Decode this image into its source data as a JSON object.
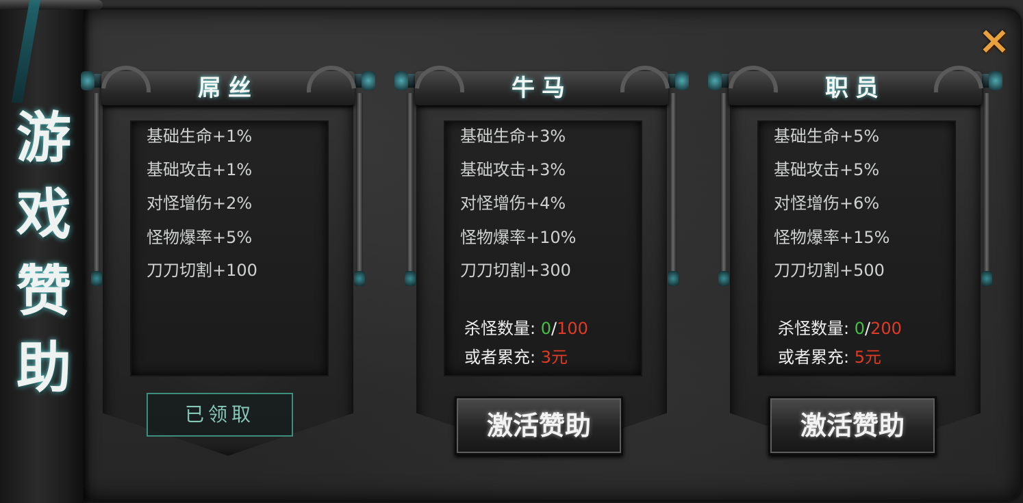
{
  "side_title": "游\n戏\n赞\n助",
  "close_icon": "×",
  "tiers": [
    {
      "title": "屌丝",
      "stats": [
        "基础生命+1%",
        "基础攻击+1%",
        "对怪增伤+2%",
        "怪物爆率+5%",
        "刀刀切割+100"
      ],
      "button": "已领取"
    },
    {
      "title": "牛马",
      "stats": [
        "基础生命+3%",
        "基础攻击+3%",
        "对怪增伤+4%",
        "怪物爆率+10%",
        "刀刀切割+300"
      ],
      "kill_label": "杀怪数量:",
      "kill_current": "0",
      "kill_sep": "/",
      "kill_target": "100",
      "recharge_label": "或者累充:",
      "recharge_amount": "3元",
      "button": "激活赞助"
    },
    {
      "title": "职员",
      "stats": [
        "基础生命+5%",
        "基础攻击+5%",
        "对怪增伤+6%",
        "怪物爆率+15%",
        "刀刀切割+500"
      ],
      "kill_label": "杀怪数量:",
      "kill_current": "0",
      "kill_sep": "/",
      "kill_target": "200",
      "recharge_label": "或者累充:",
      "recharge_amount": "5元",
      "button": "激活赞助"
    }
  ],
  "colors": {
    "progress_current": "#43c043",
    "target_red": "#e23a24",
    "close_orange": "#e8a13c"
  }
}
